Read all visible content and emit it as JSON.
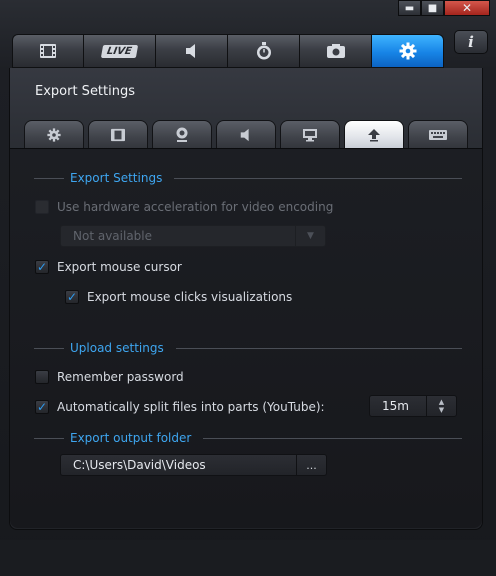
{
  "window": {
    "controls": {
      "minimize": "▬",
      "maximize": "■",
      "close": "✕"
    },
    "info_icon": "i"
  },
  "main_tabs": [
    {
      "name": "video",
      "icon": "film-icon"
    },
    {
      "name": "live",
      "label": "LIVE"
    },
    {
      "name": "audio",
      "icon": "speaker-icon"
    },
    {
      "name": "timer",
      "icon": "stopwatch-icon"
    },
    {
      "name": "screenshot",
      "icon": "camera-icon"
    },
    {
      "name": "settings",
      "icon": "gear-icon",
      "active": true
    }
  ],
  "panel": {
    "title": "Export Settings",
    "sub_tabs": [
      {
        "icon": "gear-icon"
      },
      {
        "icon": "film-icon"
      },
      {
        "icon": "webcam-icon"
      },
      {
        "icon": "speaker-icon"
      },
      {
        "icon": "monitor-icon"
      },
      {
        "icon": "upload-icon",
        "active": true
      },
      {
        "icon": "keyboard-icon"
      }
    ]
  },
  "export_settings": {
    "header": "Export Settings",
    "hw_accel": {
      "label": "Use hardware acceleration for video encoding",
      "checked": false,
      "enabled": false
    },
    "encoder_select": {
      "value": "Not available",
      "enabled": false
    },
    "mouse_cursor": {
      "label": "Export mouse cursor",
      "checked": true
    },
    "mouse_clicks": {
      "label": "Export mouse clicks visualizations",
      "checked": true
    }
  },
  "upload_settings": {
    "header": "Upload settings",
    "remember_password": {
      "label": "Remember password",
      "checked": false
    },
    "split_files": {
      "label": "Automatically split files into parts (YouTube):",
      "checked": true
    },
    "split_duration": {
      "value": "15m"
    }
  },
  "output_folder": {
    "header": "Export output folder",
    "path": "C:\\Users\\David\\Videos",
    "browse_label": "..."
  },
  "colors": {
    "accent": "#3ea6f0",
    "active_tab": "#1784e6",
    "close_button": "#c0392b"
  }
}
